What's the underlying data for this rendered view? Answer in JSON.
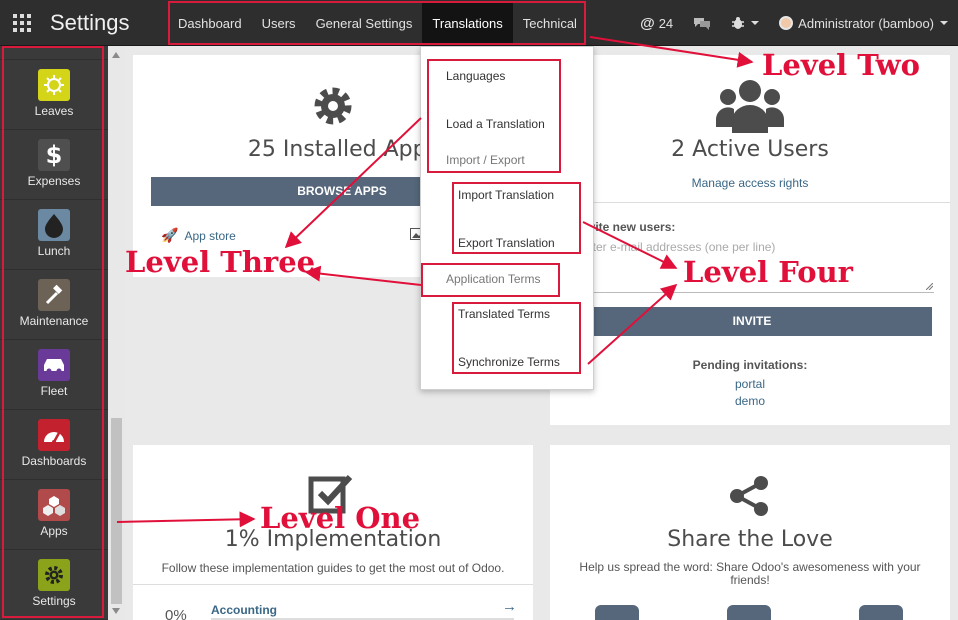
{
  "app": {
    "title": "Settings"
  },
  "topnav": [
    {
      "label": "Dashboard"
    },
    {
      "label": "Users"
    },
    {
      "label": "General Settings"
    },
    {
      "label": "Translations",
      "active": true
    },
    {
      "label": "Technical"
    }
  ],
  "topright": {
    "mentions_count": "24",
    "user": "Administrator (bamboo)"
  },
  "sidebar": {
    "items": [
      {
        "label": "Leaves",
        "icon": "sun-icon",
        "color": "#d4d419"
      },
      {
        "label": "Expenses",
        "icon": "dollar-icon",
        "color": "#4f4f4f"
      },
      {
        "label": "Lunch",
        "icon": "drop-icon",
        "color": "#6b89a2"
      },
      {
        "label": "Maintenance",
        "icon": "hammer-icon",
        "color": "#6d6256"
      },
      {
        "label": "Fleet",
        "icon": "car-icon",
        "color": "#6a3a98"
      },
      {
        "label": "Dashboards",
        "icon": "gauge-icon",
        "color": "#c4212e"
      },
      {
        "label": "Apps",
        "icon": "cubes-icon",
        "color": "#b14a4a"
      },
      {
        "label": "Settings",
        "icon": "gear-icon",
        "color": "#8aa31a"
      }
    ]
  },
  "apps_panel": {
    "title": "25 Installed Apps",
    "button": "BROWSE APPS",
    "app_store_link": "App store"
  },
  "users_panel": {
    "title": "2 Active Users",
    "manage_link": "Manage access rights",
    "invite_label": "Invite new users:",
    "invite_placeholder": "Enter e-mail addresses (one per line)",
    "invite_button": "INVITE",
    "pending_label": "Pending invitations:",
    "pending": [
      "portal",
      "demo"
    ]
  },
  "impl_panel": {
    "title": "1% Implementation",
    "subtitle": "Follow these implementation guides to get the most out of Odoo.",
    "progress_text": "0%",
    "progress": 0,
    "item": "Accounting"
  },
  "share_panel": {
    "title": "Share the Love",
    "subtitle": "Help us spread the word: Share Odoo's awesomeness with your friends!"
  },
  "dropdown": {
    "languages": "Languages",
    "load_translation": "Load a Translation",
    "import_export_header": "Import / Export",
    "import_translation": "Import Translation",
    "export_translation": "Export Translation",
    "application_terms": "Application Terms",
    "translated_terms": "Translated Terms",
    "synchronize_terms": "Synchronize Terms"
  },
  "annotations": {
    "level_one": "Level One",
    "level_two": "Level Two",
    "level_three": "Level Three",
    "level_four": "Level Four",
    "color": "#e0103a"
  }
}
